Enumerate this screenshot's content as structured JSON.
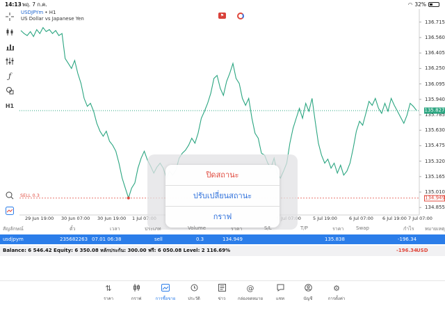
{
  "status_bar": {
    "time": "14:13",
    "date": "พฤ. 7 ก.ค.",
    "battery": "32%",
    "battery_level": 0.32
  },
  "chart": {
    "symbol": "USDJPYm",
    "timeframe": "H1",
    "description": "US Dollar vs Japanese Yen",
    "timeframe_button": "H1",
    "current_price": "135.827",
    "sell_label": "SELL 0.3",
    "sell_price": "134.949",
    "price_axis": [
      "136.715",
      "136.560",
      "136.405",
      "136.250",
      "136.095",
      "135.940",
      "135.785",
      "135.630",
      "135.475",
      "135.320",
      "135.165",
      "135.010",
      "134.855"
    ],
    "time_axis": [
      "29 Jun 19:00",
      "30 Jun 07:00",
      "30 Jun 19:00",
      "1 Jul 07:00",
      "5 Jul 07:00",
      "5 Jul 19:00",
      "6 Jul 07:00",
      "6 Jul 19:00",
      "7 Jul 07:00"
    ],
    "line_color": "#2aa580"
  },
  "chart_data": {
    "type": "line",
    "ylim": [
      134.78,
      136.79
    ],
    "series": [
      {
        "values": [
          136.63,
          136.6,
          136.58,
          136.62,
          136.57,
          136.64,
          136.6,
          136.66,
          136.62,
          136.64,
          136.6,
          136.63,
          136.58,
          136.6,
          136.35,
          136.3,
          136.25,
          136.33,
          136.2,
          136.1,
          135.95,
          135.87,
          135.9,
          135.82,
          135.7,
          135.62,
          135.57,
          135.62,
          135.52,
          135.48,
          135.42,
          135.3,
          135.15,
          135.05,
          134.95,
          135.05,
          135.1,
          135.25,
          135.35,
          135.42,
          135.33,
          135.27,
          135.2,
          135.26,
          135.3,
          135.25,
          135.15,
          135.22,
          135.18,
          135.23,
          135.35,
          135.4,
          135.43,
          135.48,
          135.55,
          135.5,
          135.6,
          135.75,
          135.82,
          135.9,
          136.0,
          136.15,
          136.18,
          136.05,
          135.98,
          136.12,
          136.2,
          136.3,
          136.15,
          136.1,
          135.95,
          135.88,
          135.95,
          135.75,
          135.6,
          135.55,
          135.4,
          135.38,
          135.3,
          135.25,
          135.35,
          135.2,
          135.15,
          135.22,
          135.3,
          135.5,
          135.65,
          135.75,
          135.85,
          135.75,
          135.9,
          135.82,
          135.95,
          135.72,
          135.5,
          135.38,
          135.3,
          135.34,
          135.25,
          135.3,
          135.2,
          135.28,
          135.18,
          135.22,
          135.3,
          135.45,
          135.62,
          135.72,
          135.68,
          135.8,
          135.92,
          135.88,
          135.95,
          135.85,
          135.8,
          135.9,
          135.82,
          135.95,
          135.88,
          135.82,
          135.76,
          135.7,
          135.78,
          135.9,
          135.87,
          135.83
        ]
      }
    ]
  },
  "popup": {
    "close_position": "ปิดสถานะ",
    "modify_position": "ปรับเปลี่ยนสถานะ",
    "chart": "กราฟ"
  },
  "table": {
    "headers": [
      "สัญลักษณ์",
      "ตั๋ว",
      "เวลา",
      "ประเภท",
      "Volume",
      "ราคา",
      "S/L",
      "T/P",
      "ราคา",
      "Swap",
      "กำไร",
      "หมายเหตุ"
    ],
    "row": {
      "symbol": "usdjpym",
      "ticket": "235682263",
      "time": "07.01 06:38",
      "type": "sell",
      "volume": "0.3",
      "price": "134.949",
      "current": "135.838",
      "profit": "-196.34"
    },
    "balance": "Balance: 6 546.42 Equity: 6 350.08 หลักประกัน: 300.00 ฟรี: 6 050.08 Level: 2 116.69%",
    "balance_profit": "-196.34",
    "balance_currency": "USD"
  },
  "nav": [
    {
      "label": "ราคา",
      "icon": "quotes-icon"
    },
    {
      "label": "กราฟ",
      "icon": "candles-icon"
    },
    {
      "label": "การซื้อขาย",
      "icon": "trade-icon",
      "active": true
    },
    {
      "label": "ประวัติ",
      "icon": "history-icon"
    },
    {
      "label": "ข่าว",
      "icon": "news-icon"
    },
    {
      "label": "กล่องจดหมาย",
      "icon": "mail-icon"
    },
    {
      "label": "แชท",
      "icon": "chat-icon"
    },
    {
      "label": "บัญชี",
      "icon": "account-icon"
    },
    {
      "label": "การตั้งค่า",
      "icon": "settings-icon"
    }
  ]
}
